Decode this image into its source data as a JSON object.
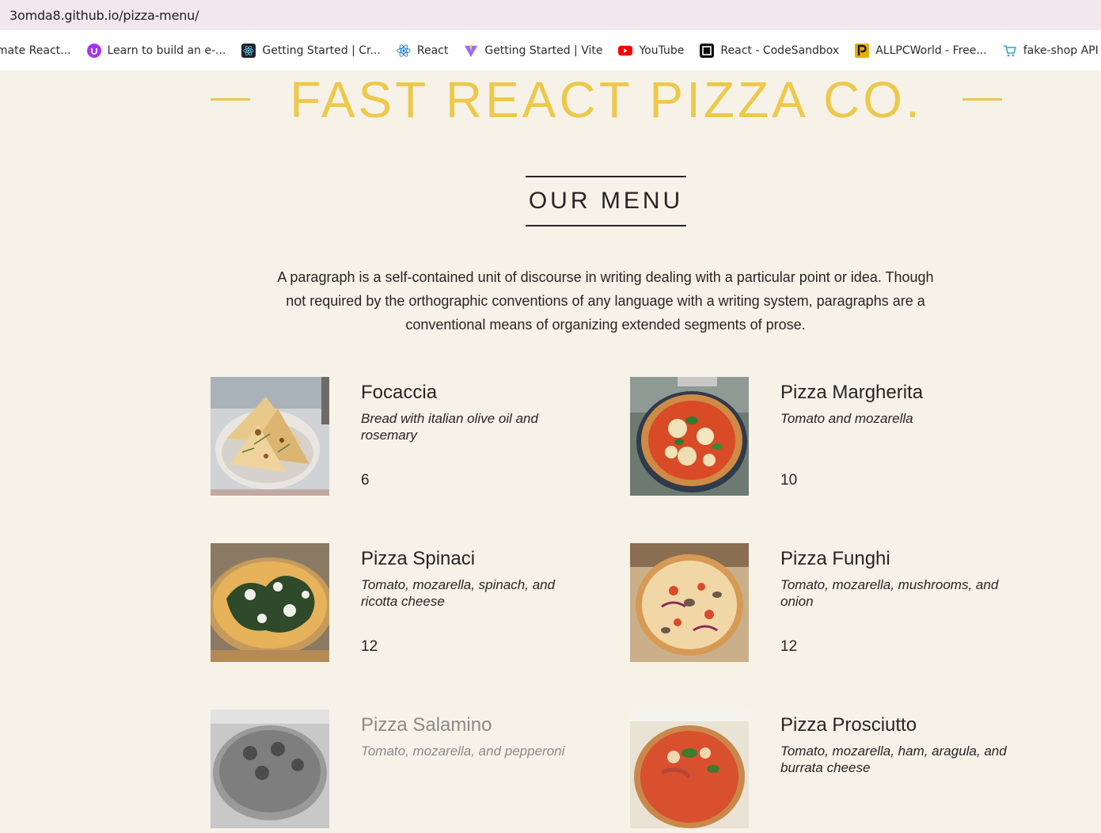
{
  "browser": {
    "url": "3omda8.github.io/pizza-menu/",
    "bookmarks": [
      {
        "label": "imate React...",
        "icon": "none"
      },
      {
        "label": "Learn to build an e-...",
        "icon": "udemy-icon"
      },
      {
        "label": "Getting Started | Cr...",
        "icon": "react-app-icon"
      },
      {
        "label": "React",
        "icon": "react-icon"
      },
      {
        "label": "Getting Started | Vite",
        "icon": "vite-icon"
      },
      {
        "label": "YouTube",
        "icon": "youtube-icon"
      },
      {
        "label": "React - CodeSandbox",
        "icon": "codesandbox-icon"
      },
      {
        "label": "ALLPCWorld - Free...",
        "icon": "allpcworld-icon"
      },
      {
        "label": "fake-shop API",
        "icon": "cart-icon"
      }
    ]
  },
  "header": {
    "title": "FAST REACT PIZZA CO."
  },
  "menu": {
    "title": "OUR MENU",
    "intro": "A paragraph is a self-contained unit of discourse in writing dealing with a particular point or idea. Though not required by the orthographic conventions of any language with a writing system, paragraphs are a conventional means of organizing extended segments of prose.",
    "pizzas": [
      {
        "name": "Focaccia",
        "ingredients": "Bread with italian olive oil and rosemary",
        "price": "6"
      },
      {
        "name": "Pizza Margherita",
        "ingredients": "Tomato and mozarella",
        "price": "10"
      },
      {
        "name": "Pizza Spinaci",
        "ingredients": "Tomato, mozarella, spinach, and ricotta cheese",
        "price": "12"
      },
      {
        "name": "Pizza Funghi",
        "ingredients": "Tomato, mozarella, mushrooms, and onion",
        "price": "12"
      },
      {
        "name": "Pizza Salamino",
        "ingredients": "Tomato, mozarella, and pepperoni",
        "price": ""
      },
      {
        "name": "Pizza Prosciutto",
        "ingredients": "Tomato, mozarella, ham, aragula, and burrata cheese",
        "price": ""
      }
    ]
  },
  "colors": {
    "accent": "#edc84b",
    "background": "#f7f2e8",
    "text": "#252525",
    "soldout": "#8a8a8a"
  }
}
